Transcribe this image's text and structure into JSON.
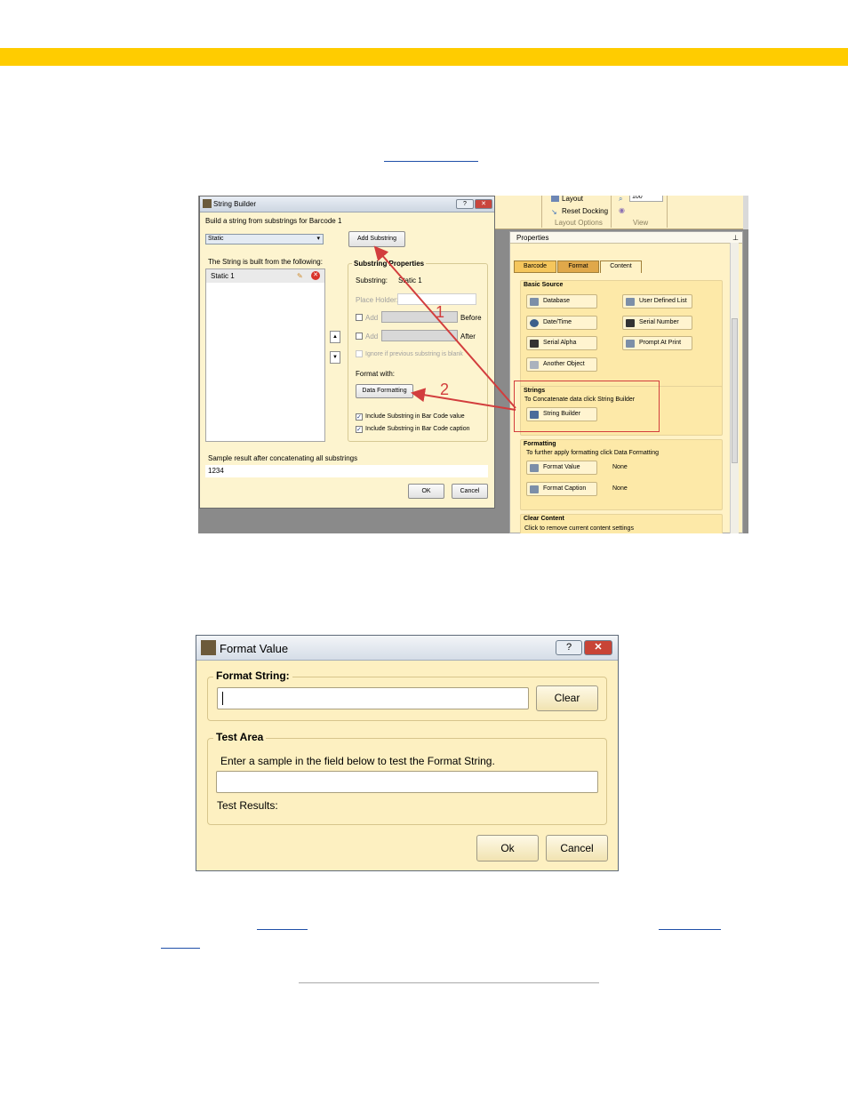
{
  "page": {
    "header_band_color": "#ffcc00",
    "link_color": "#1f4fa8"
  },
  "string_builder": {
    "title": "String Builder",
    "window_buttons": [
      "?",
      "✕"
    ],
    "subtitle": "Build a string from substrings for Barcode 1",
    "type_value": "Static",
    "add_substring": "Add Substring",
    "list_header": "The String is built from the following:",
    "list_items": [
      "Static 1"
    ],
    "props_title": "Substring Properties",
    "substring_label": "Substring:",
    "substring_value": "Static 1",
    "placeholder_label": "Place Holder:",
    "add_label": "Add",
    "before_label": "Before",
    "after_label": "After",
    "ignore_label": "Ignore if previous substring is blank",
    "format_with": "Format with:",
    "data_formatting": "Data Formatting",
    "include_value": "Include Substring in Bar Code value",
    "include_caption": "Include Substring in Bar Code caption",
    "sample_label": "Sample result after concatenating all substrings",
    "sample_value": "1234",
    "ok": "OK",
    "cancel": "Cancel"
  },
  "ribbon": {
    "layout": "Layout",
    "reset_docking": "Reset Docking",
    "layout_options": "Layout Options",
    "zoom": "100",
    "view": "View"
  },
  "properties": {
    "title": "Properties",
    "pin": "ᵖ",
    "tabs": [
      "Barcode",
      "Format",
      "Content"
    ],
    "basic_source": "Basic Source",
    "source_buttons": [
      "Database",
      "User Defined List",
      "Date/Time",
      "Serial Number",
      "Serial Alpha",
      "Prompt At Print",
      "Another Object"
    ],
    "strings_head": "Strings",
    "strings_desc": "To Concatenate data click String Builder",
    "string_builder_btn": "String Builder",
    "formatting_head": "Formatting",
    "formatting_desc": "To further apply formatting click Data Formatting",
    "format_value": "Format Value",
    "format_caption": "Format Caption",
    "none": "None",
    "clear_head": "Clear Content",
    "clear_desc": "Click to remove current content settings"
  },
  "annotations": {
    "one": "1",
    "two": "2",
    "color": "#d23d3d"
  },
  "format_value_dialog": {
    "title": "Format Value",
    "window_buttons": [
      "?",
      "✕"
    ],
    "format_string_label": "Format String:",
    "format_string_value": "",
    "clear": "Clear",
    "test_area_label": "Test Area",
    "test_instructions": "Enter a sample in the field below to test the Format String.",
    "test_input_value": "",
    "test_results": "Test Results:",
    "ok": "Ok",
    "cancel": "Cancel"
  }
}
